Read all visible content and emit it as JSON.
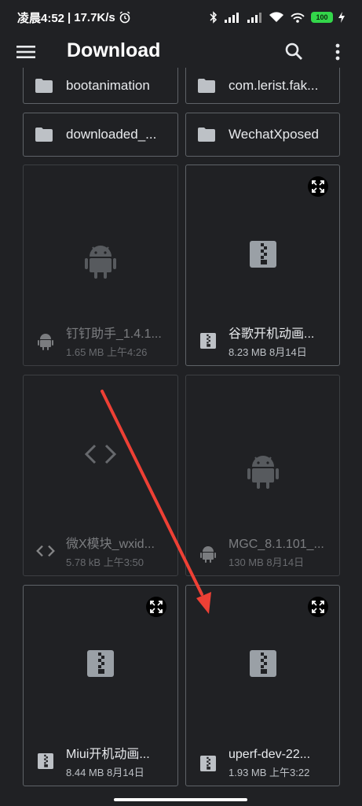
{
  "status_bar": {
    "time": "凌晨4:52",
    "speed": "17.7K/s",
    "battery": "100"
  },
  "toolbar": {
    "title": "Download"
  },
  "folders": [
    {
      "name": "bootanimation"
    },
    {
      "name": "com.lerist.fak..."
    },
    {
      "name": "downloaded_..."
    },
    {
      "name": "WechatXposed"
    }
  ],
  "files": [
    {
      "name": "钉钉助手_1.4.1...",
      "info": "1.65 MB 上午4:26",
      "type": "apk"
    },
    {
      "name": "谷歌开机动画...",
      "info": "8.23 MB 8月14日",
      "type": "zip"
    },
    {
      "name": "微X模块_wxid...",
      "info": "5.78 kB 上午3:50",
      "type": "code"
    },
    {
      "name": "MGC_8.1.101_...",
      "info": "130 MB 8月14日",
      "type": "apk"
    },
    {
      "name": "Miui开机动画...",
      "info": "8.44 MB 8月14日",
      "type": "zip"
    },
    {
      "name": "uperf-dev-22...",
      "info": "1.93 MB 上午3:22",
      "type": "zip"
    }
  ],
  "colors": {
    "background": "#202124",
    "card_border": "#5f6368",
    "icon_gray": "#5f6368",
    "annotation_arrow": "#ee4035"
  }
}
